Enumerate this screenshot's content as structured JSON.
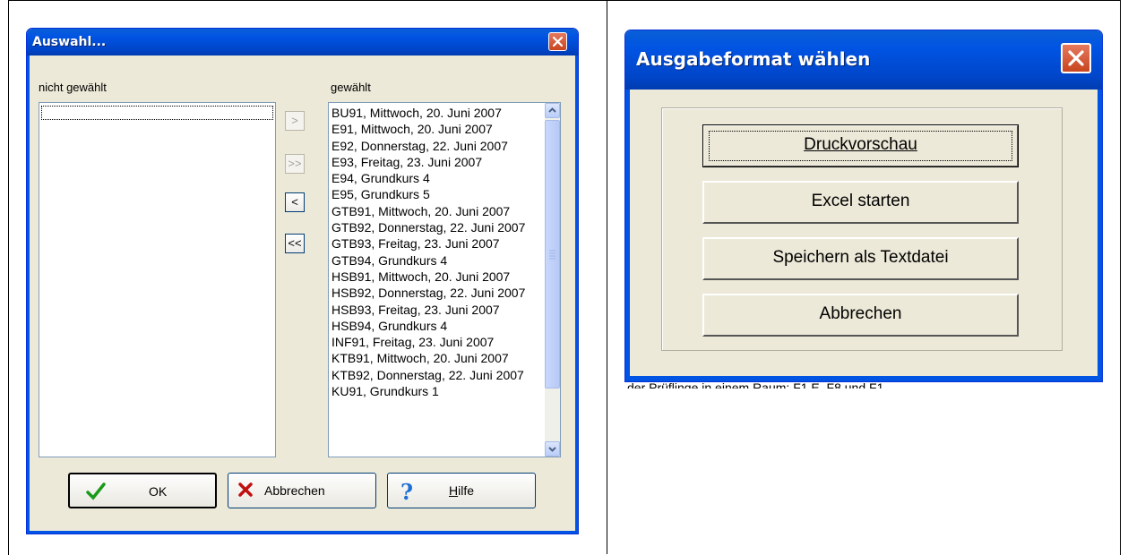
{
  "background_doc": {
    "partial_text": "der Prüflinge in einem Raum: F1 E, F8 und F1"
  },
  "auswahl_dialog": {
    "title": "Auswahl...",
    "not_selected_label": "nicht gewählt",
    "selected_label": "gewählt",
    "not_selected_items": [],
    "selected_items": [
      "BU91, Mittwoch, 20. Juni 2007",
      "E91, Mittwoch, 20. Juni 2007",
      "E92, Donnerstag, 22. Juni 2007",
      "E93, Freitag, 23. Juni 2007",
      "E94, Grundkurs 4",
      "E95, Grundkurs 5",
      "GTB91, Mittwoch, 20. Juni 2007",
      "GTB92, Donnerstag, 22. Juni 2007",
      "GTB93, Freitag, 23. Juni 2007",
      "GTB94, Grundkurs 4",
      "HSB91, Mittwoch, 20. Juni 2007",
      "HSB92, Donnerstag, 22. Juni 2007",
      "HSB93, Freitag, 23. Juni 2007",
      "HSB94, Grundkurs 4",
      "INF91, Freitag, 23. Juni 2007",
      "KTB91, Mittwoch, 20. Juni 2007",
      "KTB92, Donnerstag, 22. Juni 2007",
      "KU91, Grundkurs 1"
    ],
    "move_buttons": {
      "add_one": ">",
      "add_all": ">>",
      "remove_one": "<",
      "remove_all": "<<"
    },
    "buttons": {
      "ok": "OK",
      "cancel": "Abbrechen",
      "help": "Hilfe"
    }
  },
  "ausgabe_dialog": {
    "title": "Ausgabeformat wählen",
    "buttons": {
      "preview": "Druckvorschau",
      "excel": "Excel starten",
      "save_text": "Speichern als Textdatei",
      "cancel": "Abbrechen"
    }
  },
  "colors": {
    "titlebar": "#0054e3",
    "dialog_bg": "#ece9d8",
    "close_button": "#d6522c",
    "check_icon": "#1a9a1a",
    "cross_icon": "#c01010",
    "help_icon": "#1c6fd6"
  }
}
